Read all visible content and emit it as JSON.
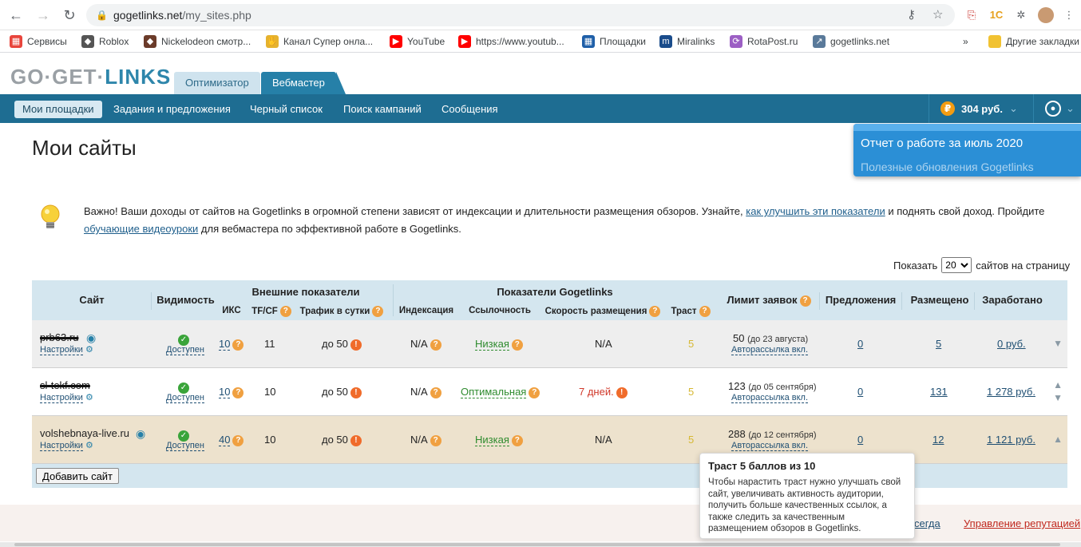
{
  "browser": {
    "url_domain": "gogetlinks.net",
    "url_path": "/my_sites.php"
  },
  "bookmarks": [
    {
      "label": "Сервисы",
      "icon": "apps-icon",
      "color": "#e8453c"
    },
    {
      "label": "Roblox",
      "icon": "roblox-icon",
      "color": "#555555"
    },
    {
      "label": "Nickelodeon смотр...",
      "icon": "nickelodeon-icon",
      "color": "#6b3b2a"
    },
    {
      "label": "Канал Супер онла...",
      "icon": "hand-icon",
      "color": "#e6b22e"
    },
    {
      "label": "YouTube",
      "icon": "youtube-icon",
      "color": "#ff0000"
    },
    {
      "label": "https://www.youtub...",
      "icon": "youtube-icon",
      "color": "#ff0000"
    },
    {
      "label": "Площадки",
      "icon": "sape-icon",
      "color": "#1f5fa8"
    },
    {
      "label": "Miralinks",
      "icon": "miralinks-icon",
      "color": "#1a4c8b"
    },
    {
      "label": "RotaPost.ru",
      "icon": "rotapost-icon",
      "color": "#9c5fc4"
    },
    {
      "label": "gogetlinks.net",
      "icon": "chart-icon",
      "color": "#5a7a9a"
    }
  ],
  "bookmarks_more": "»",
  "bookmarks_other": "Другие закладки",
  "site": {
    "logo_gray": "GO·GET·",
    "logo_blue": "LINKS",
    "tab_optimizer": "Оптимизатор",
    "tab_webmaster": "Вебмастер",
    "nav": [
      "Мои площадки",
      "Задания и предложения",
      "Черный список",
      "Поиск кампаний",
      "Сообщения"
    ],
    "balance": "304 руб.",
    "balance_symbol": "₽"
  },
  "notification": {
    "line1": "Отчет о работе за июль 2020",
    "line2": "Полезные обновления Gogetlinks"
  },
  "page_title": "Мои сайты",
  "notice": {
    "t1": "Важно! Ваши доходы от сайтов на Gogetlinks в огромной степени зависят от индексации и длительности размещения обзоров. Узнайте, ",
    "link1": "как улучшить эти показатели",
    "t2": " и поднять свой доход. Пройдите ",
    "link2": "обучающие видеоуроки",
    "t3": " для вебмастера по эффективной работе в Gogetlinks."
  },
  "perpage": {
    "label_before": "Показать",
    "value": "20",
    "label_after": "сайтов на страницу"
  },
  "table": {
    "headers": {
      "site": "Сайт",
      "visibility": "Видимость",
      "external": "Внешние показатели",
      "gogetlinks": "Показатели Gogetlinks",
      "iks": "ИКС",
      "tfcf": "TF/CF",
      "traffic": "Трафик в сутки",
      "indexing": "Индексация",
      "links": "Ссылочность",
      "speed": "Скорость размещения",
      "trust": "Траст",
      "limit": "Лимит заявок",
      "offers": "Предложения",
      "placed": "Размещено",
      "earned": "Заработано"
    },
    "rows": [
      {
        "site": "prb63.ru",
        "settings": "Настройки",
        "visibility": "Доступен",
        "iks": "10",
        "tfcf": "11",
        "traffic": "до 50",
        "indexing": "N/A",
        "links": "Низкая",
        "speed": "N/A",
        "trust": "5",
        "limit": "50",
        "limit_date": "(до 23 августа)",
        "autosend": "Авторассылка вкл.",
        "offers": "0",
        "placed": "5",
        "earned": "0 руб."
      },
      {
        "site": "sl-tekf.com",
        "settings": "Настройки",
        "visibility": "Доступен",
        "iks": "10",
        "tfcf": "10",
        "traffic": "до 50",
        "indexing": "N/A",
        "links": "Оптимальная",
        "speed": "7 дней.",
        "trust": "5",
        "limit": "123",
        "limit_date": "(до 05 сентября)",
        "autosend": "Авторассылка вкл.",
        "offers": "0",
        "placed": "131",
        "earned": "1 278 руб."
      },
      {
        "site": "volshebnaya-live.ru",
        "settings": "Настройки",
        "visibility": "Доступен",
        "iks": "40",
        "tfcf": "10",
        "traffic": "до 50",
        "indexing": "N/A",
        "links": "Низкая",
        "speed": "N/A",
        "trust": "5",
        "limit": "288",
        "limit_date": "(до 12 сентября)",
        "autosend": "Авторассылка вкл.",
        "offers": "0",
        "placed": "12",
        "earned": "1 121 руб."
      }
    ],
    "add_button": "Добавить сайт",
    "help_mark": "?",
    "warn_mark": "!"
  },
  "tooltip": {
    "title": "Траст 5 баллов из 10",
    "body": "Чтобы нарастить траст нужно улучшать свой сайт, увеличивать активность аудитории, получить больше качественных ссылок, а также следить за качественным размещением обзоров в Gogetlinks."
  },
  "footer": {
    "link1": "сегда",
    "link2": "Управление репутацией"
  }
}
